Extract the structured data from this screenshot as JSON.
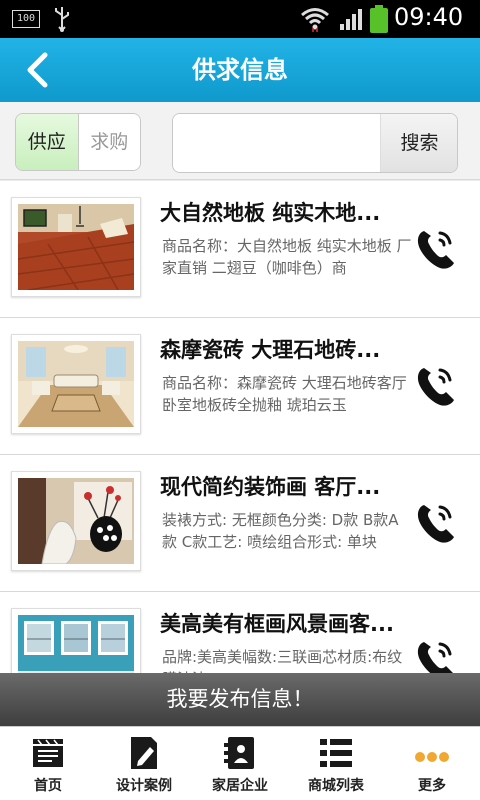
{
  "status_bar": {
    "battery_badge": "100",
    "time": "09:40",
    "icons": [
      "usb-icon",
      "wifi-icon",
      "signal-icon",
      "battery-icon"
    ]
  },
  "header": {
    "title": "供求信息",
    "back_icon": "back-arrow-icon"
  },
  "filter": {
    "tabs": [
      {
        "label": "供应",
        "active": true
      },
      {
        "label": "求购",
        "active": false
      }
    ],
    "search": {
      "value": "",
      "placeholder": "",
      "button_label": "搜索"
    }
  },
  "items": [
    {
      "title": "大自然地板 纯实木地...",
      "desc": "商品名称：大自然地板 纯实木地板 厂家直销 二翅豆（咖啡色）商",
      "image": "wood-floor-image"
    },
    {
      "title": "森摩瓷砖 大理石地砖...",
      "desc": "商品名称：森摩瓷砖 大理石地砖客厅卧室地板砖全抛釉 琥珀云玉",
      "image": "living-room-image"
    },
    {
      "title": "现代简约装饰画 客厅...",
      "desc": "装裱方式: 无框颜色分类: D款 B款A款 C款工艺: 喷绘组合形式: 单块",
      "image": "decorative-painting-image"
    },
    {
      "title": "美高美有框画风景画客...",
      "desc": "品牌:美高美幅数:三联画芯材质:布纹膜油漆:",
      "image": "landscape-painting-image"
    }
  ],
  "publish_label": "我要发布信息！",
  "bottom_nav": [
    {
      "label": "首页",
      "icon": "home-icon"
    },
    {
      "label": "设计案例",
      "icon": "design-icon"
    },
    {
      "label": "家居企业",
      "icon": "company-icon"
    },
    {
      "label": "商城列表",
      "icon": "list-icon"
    },
    {
      "label": "更多",
      "icon": "more-icon"
    }
  ],
  "colors": {
    "header": "#16a6da",
    "active_tab": "#d4f3c8",
    "publish_bar": "#555555",
    "more_dots": "#f0a830"
  }
}
